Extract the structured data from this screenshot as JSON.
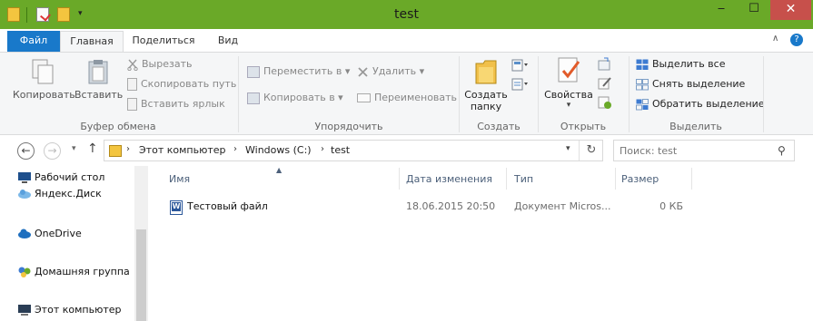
{
  "window": {
    "title": "test",
    "minimize": "‒",
    "maximize": "☐",
    "close": "✕"
  },
  "quick_access": {
    "dropdown": "▾"
  },
  "ribbon_tabs": {
    "file": "Файл",
    "home": "Главная",
    "share": "Поделиться",
    "view": "Вид",
    "collapse": "∧",
    "help": "?"
  },
  "ribbon": {
    "clipboard": {
      "copy": "Копировать",
      "paste": "Вставить",
      "cut": "Вырезать",
      "copy_path": "Скопировать путь",
      "paste_shortcut": "Вставить ярлык",
      "label": "Буфер обмена"
    },
    "organize": {
      "move_to": "Переместить в ▾",
      "copy_to": "Копировать в ▾",
      "delete": "Удалить ▾",
      "rename": "Переименовать",
      "label": "Упорядочить"
    },
    "new": {
      "new_folder_line1": "Создать",
      "new_folder_line2": "папку",
      "label": "Создать"
    },
    "open": {
      "properties": "Свойства",
      "properties_arrow": "▾",
      "label": "Открыть"
    },
    "select": {
      "select_all": "Выделить все",
      "select_none": "Снять выделение",
      "invert": "Обратить выделение",
      "label": "Выделить"
    }
  },
  "address": {
    "back": "←",
    "forward": "→",
    "recent": "▾",
    "up": "↑",
    "crumb_sep": "›",
    "crumbs": [
      "Этот компьютер",
      "Windows (C:)",
      "test"
    ],
    "dropdown": "▾",
    "refresh": "↻"
  },
  "search": {
    "placeholder": "Поиск: test",
    "icon": "⚲"
  },
  "nav_pane": {
    "items": [
      "Рабочий стол",
      "Яндекс.Диск",
      "OneDrive",
      "Домашняя группа",
      "Этот компьютер"
    ]
  },
  "file_list": {
    "sort_indicator": "▲",
    "columns": [
      "Имя",
      "Дата изменения",
      "Тип",
      "Размер"
    ],
    "rows": [
      {
        "name": "Тестовый файл",
        "date": "18.06.2015 20:50",
        "type": "Документ Micros...",
        "size": "0 КБ"
      }
    ]
  },
  "colors": {
    "title_bar": "#6aa928",
    "file_tab": "#1979ca",
    "close_button": "#c7504b",
    "ribbon_bg": "#f5f6f7",
    "column_header_text": "#4c607a"
  },
  "icons": [
    "folder-icon",
    "properties-icon",
    "copy-icon",
    "paste-icon",
    "cut-icon",
    "copy-path-icon",
    "paste-shortcut-icon",
    "move-to-icon",
    "copy-to-icon",
    "delete-icon",
    "rename-icon",
    "new-folder-icon",
    "new-item-icon",
    "easy-access-icon",
    "open-icon",
    "edit-icon",
    "history-icon",
    "select-all-icon",
    "select-none-icon",
    "invert-selection-icon",
    "desktop-icon",
    "cloud-icon",
    "onedrive-icon",
    "homegroup-icon",
    "computer-icon",
    "word-document-icon",
    "search-icon"
  ]
}
